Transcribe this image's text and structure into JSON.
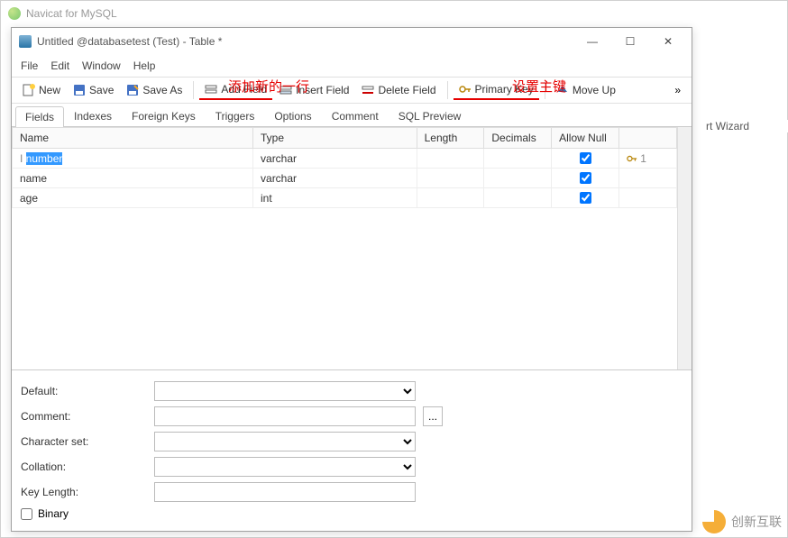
{
  "outer": {
    "title": "Navicat for MySQL"
  },
  "inner": {
    "title": "Untitled @databasetest (Test) - Table *",
    "controls": {
      "min": "—",
      "max": "☐",
      "close": "✕"
    }
  },
  "menu": [
    "File",
    "Edit",
    "Window",
    "Help"
  ],
  "annotations": {
    "add_row": "添加新的一行",
    "set_pk": "设置主键"
  },
  "toolbar": {
    "new": "New",
    "save": "Save",
    "save_as": "Save As",
    "add_field": "Add Field",
    "insert_field": "Insert Field",
    "delete_field": "Delete Field",
    "primary_key": "Primary Key",
    "move_up": "Move Up",
    "overflow": "»"
  },
  "tabs": [
    "Fields",
    "Indexes",
    "Foreign Keys",
    "Triggers",
    "Options",
    "Comment",
    "SQL Preview"
  ],
  "active_tab": 0,
  "grid": {
    "headers": [
      "Name",
      "Type",
      "Length",
      "Decimals",
      "Allow Null",
      ""
    ],
    "rows": [
      {
        "name": "number",
        "type": "varchar",
        "length": "",
        "decimals": "",
        "allow_null": true,
        "key": "1",
        "selected": true
      },
      {
        "name": "name",
        "type": "varchar",
        "length": "",
        "decimals": "",
        "allow_null": true,
        "key": "",
        "selected": false
      },
      {
        "name": "age",
        "type": "int",
        "length": "",
        "decimals": "",
        "allow_null": true,
        "key": "",
        "selected": false
      }
    ]
  },
  "right_text": "rt Wizard",
  "props": {
    "default_label": "Default:",
    "comment_label": "Comment:",
    "charset_label": "Character set:",
    "collation_label": "Collation:",
    "keylen_label": "Key Length:",
    "binary_label": "Binary",
    "default": "",
    "comment": "",
    "charset": "",
    "collation": "",
    "keylen": "",
    "binary": false,
    "dots": "..."
  },
  "watermark": "创新互联"
}
